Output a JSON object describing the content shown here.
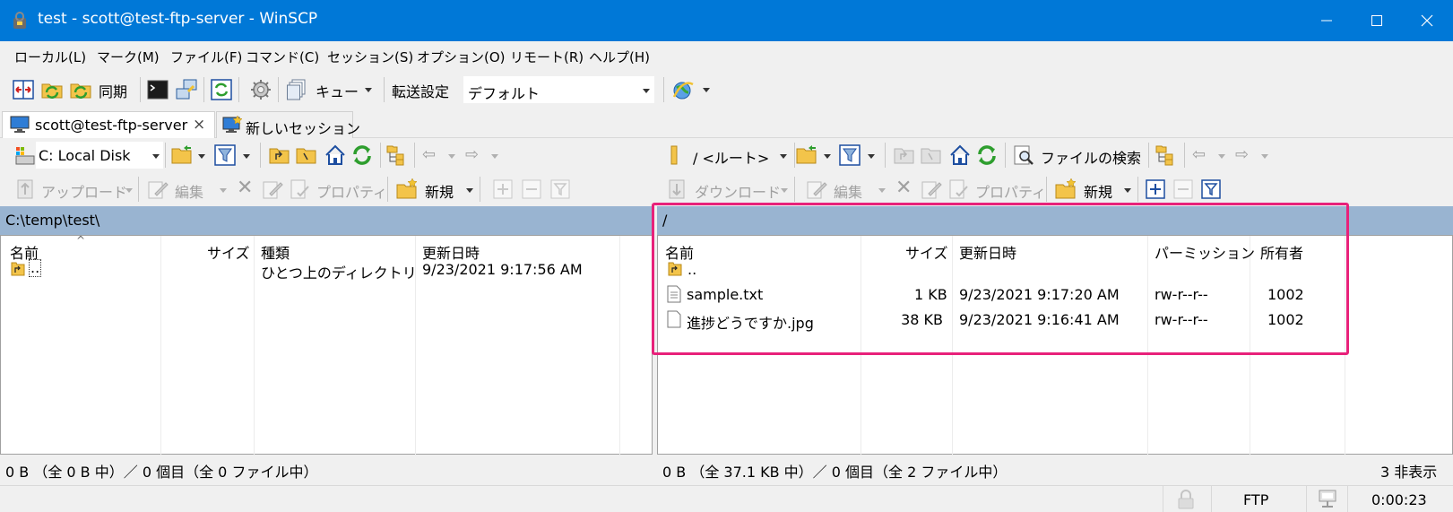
{
  "window": {
    "title": "test - scott@test-ftp-server - WinSCP",
    "app_icon": "winscp-app-icon",
    "accent": "#0078d7",
    "minimize_label": "minimize",
    "maximize_label": "maximize",
    "close_label": "close"
  },
  "menu": {
    "items": [
      {
        "label": "ローカル(L)"
      },
      {
        "label": "マーク(M)"
      },
      {
        "label": "ファイル(F)"
      },
      {
        "label": "コマンド(C)"
      },
      {
        "label": "セッション(S)"
      },
      {
        "label": "オプション(O)"
      },
      {
        "label": "リモート(R)"
      },
      {
        "label": "ヘルプ(H)"
      }
    ]
  },
  "toolbar": {
    "sync_label": "同期",
    "queue_label": "キュー",
    "transfer_label": "転送設定",
    "transfer_value": "デフォルト"
  },
  "tabs": [
    {
      "label": "scott@test-ftp-server",
      "close": "×"
    },
    {
      "label": "新しいセッション"
    }
  ],
  "local": {
    "drive": "C: Local Disk",
    "upload_label": "アップロード",
    "edit_label": "編集",
    "properties_label": "プロパティ",
    "new_label": "新規",
    "path": "C:\\temp\\test\\",
    "columns": {
      "name": "名前",
      "size": "サイズ",
      "type": "種類",
      "modified": "更新日時"
    },
    "sort_indicator": "^",
    "rows": [
      {
        "name": "..",
        "size": "",
        "type": "ひとつ上のディレクトリ",
        "modified": "9/23/2021  9:17:56 AM",
        "icon": "parent-folder-icon"
      }
    ],
    "status": "0 B （全 0 B 中）／ 0 個目（全 0 ファイル中）"
  },
  "remote": {
    "dir": "/ <ルート>",
    "find_label": "ファイルの検索",
    "download_label": "ダウンロード",
    "edit_label": "編集",
    "properties_label": "プロパティ",
    "new_label": "新規",
    "path": "/",
    "columns": {
      "name": "名前",
      "size": "サイズ",
      "modified": "更新日時",
      "permissions": "パーミッション",
      "owner": "所有者"
    },
    "rows": [
      {
        "name": "..",
        "size": "",
        "modified": "",
        "permissions": "",
        "owner": "",
        "icon": "parent-folder-icon"
      },
      {
        "name": "sample.txt",
        "size": "1 KB",
        "modified": "9/23/2021 9:17:20 AM",
        "permissions": "rw-r--r--",
        "owner": "1002",
        "icon": "text-file-icon"
      },
      {
        "name": "進捗どうですか.jpg",
        "size": "38 KB",
        "modified": "9/23/2021 9:16:41 AM",
        "permissions": "rw-r--r--",
        "owner": "1002",
        "icon": "image-file-icon"
      }
    ],
    "status": "0 B （全 37.1 KB 中）／ 0 個目（全 2 ファイル中）",
    "hidden_count": "3 非表示"
  },
  "bottom": {
    "protocol": "FTP",
    "elapsed": "0:00:23"
  },
  "colors": {
    "pathbar": "#99b4d1",
    "highlight": "#e8217a"
  }
}
